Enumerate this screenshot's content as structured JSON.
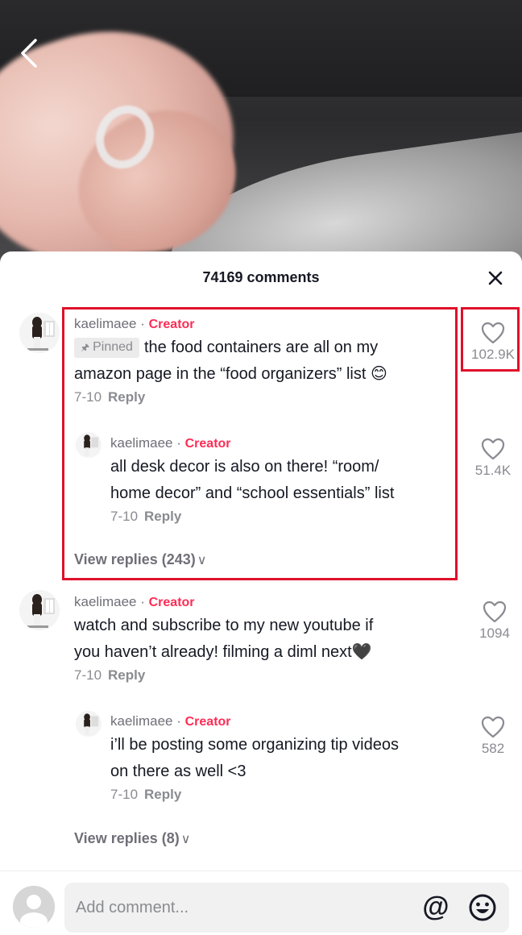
{
  "header": {
    "comments_count_label": "74169 comments"
  },
  "comments": [
    {
      "username": "kaelimaee",
      "separator": " · ",
      "creator_label": "Creator",
      "pinned_label": "Pinned",
      "text_line1": "the food containers are all on my",
      "text_line2": "amazon page in the “food organizers” list",
      "emoji": "😊",
      "date": "7-10",
      "reply_label": "Reply",
      "likes": "102.9K",
      "reply": {
        "username": "kaelimaee",
        "separator": " · ",
        "creator_label": "Creator",
        "text_line1": "all desk decor is also on there! “room/",
        "text_line2": "home decor” and “school essentials” list",
        "date": "7-10",
        "reply_label": "Reply",
        "likes": "51.4K"
      },
      "view_replies_label": "View replies (243)"
    },
    {
      "username": "kaelimaee",
      "separator": " · ",
      "creator_label": "Creator",
      "text_line1": "watch and subscribe to my new youtube if",
      "text_line2": "you haven’t already! filming a diml next",
      "emoji": "🖤",
      "date": "7-10",
      "reply_label": "Reply",
      "likes": "1094",
      "reply": {
        "username": "kaelimaee",
        "separator": " · ",
        "creator_label": "Creator",
        "text_line1": "i’ll be posting some organizing tip videos",
        "text_line2": "on there as well <3",
        "date": "7-10",
        "reply_label": "Reply",
        "likes": "582"
      },
      "view_replies_label": "View replies (8)"
    }
  ],
  "composer": {
    "placeholder": "Add comment...",
    "mention_symbol": "@"
  },
  "icons": {
    "back": "chevron-left-icon",
    "close": "close-icon",
    "like": "heart-outline-icon",
    "mention": "at-sign-icon",
    "emoji": "smiley-face-icon",
    "pin": "pin-icon",
    "chevron_down": "chevron-down-icon"
  },
  "colors": {
    "accent": "#fe2c55",
    "highlight": "#e0102a",
    "text_primary": "#161823",
    "text_secondary": "#8a8b91"
  }
}
